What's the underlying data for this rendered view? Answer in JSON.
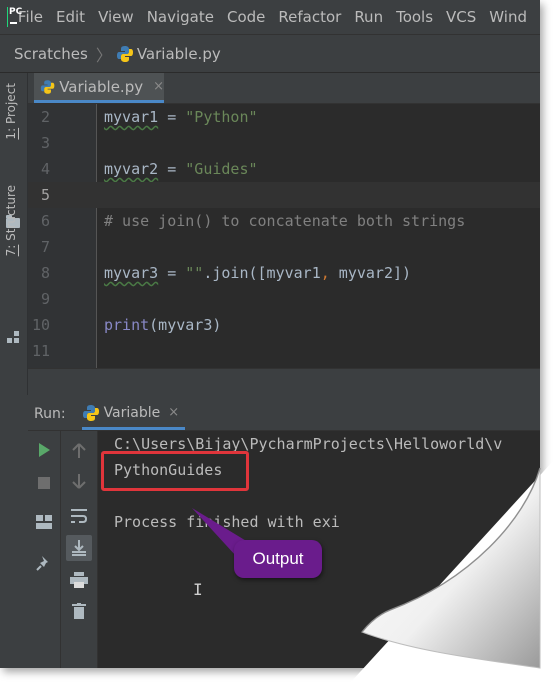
{
  "menubar": {
    "logo_text": "PC",
    "items": [
      "File",
      "Edit",
      "View",
      "Navigate",
      "Code",
      "Refactor",
      "Run",
      "Tools",
      "VCS",
      "Wind"
    ]
  },
  "breadcrumb": {
    "root": "Scratches",
    "file": "Variable.py"
  },
  "left_stripe": {
    "project_num": "1:",
    "project_label": " Project",
    "structure_num": "7:",
    "structure_label": " Structure"
  },
  "editor_tab": {
    "label": "Variable.py",
    "close": "×"
  },
  "editor": {
    "current_line": 5,
    "lines": [
      {
        "num": "2",
        "parts": [
          {
            "t": "myvar1",
            "c": "var"
          },
          {
            "t": " = ",
            "c": ""
          },
          {
            "t": "\"Python\"",
            "c": "str"
          }
        ]
      },
      {
        "num": "3",
        "parts": []
      },
      {
        "num": "4",
        "parts": [
          {
            "t": "myvar2",
            "c": "var"
          },
          {
            "t": " = ",
            "c": ""
          },
          {
            "t": "\"Guides\"",
            "c": "str"
          }
        ]
      },
      {
        "num": "5",
        "parts": []
      },
      {
        "num": "6",
        "parts": [
          {
            "t": "# use join() to concatenate both strings",
            "c": "cmt"
          }
        ]
      },
      {
        "num": "7",
        "parts": []
      },
      {
        "num": "8",
        "parts": [
          {
            "t": "myvar3",
            "c": "var"
          },
          {
            "t": " = ",
            "c": ""
          },
          {
            "t": "\"\"",
            "c": "str"
          },
          {
            "t": ".join([myvar1",
            "c": ""
          },
          {
            "t": ",",
            "c": "kw"
          },
          {
            "t": " myvar2])",
            "c": ""
          }
        ]
      },
      {
        "num": "9",
        "parts": []
      },
      {
        "num": "10",
        "parts": [
          {
            "t": "print",
            "c": "fn"
          },
          {
            "t": "(myvar3)",
            "c": ""
          }
        ]
      },
      {
        "num": "11",
        "parts": []
      }
    ]
  },
  "run_panel": {
    "label": "Run:",
    "tab_label": "Variable",
    "close": "×"
  },
  "console": {
    "lines": [
      "C:\\Users\\Bijay\\PycharmProjects\\Helloworld\\v",
      "PythonGuides",
      "",
      "Process finished with exi"
    ]
  },
  "annotation": {
    "callout_text": "Output"
  },
  "colors": {
    "accent": "#4a88c7",
    "highlight": "#e0353b",
    "callout": "#6a1c8c"
  }
}
